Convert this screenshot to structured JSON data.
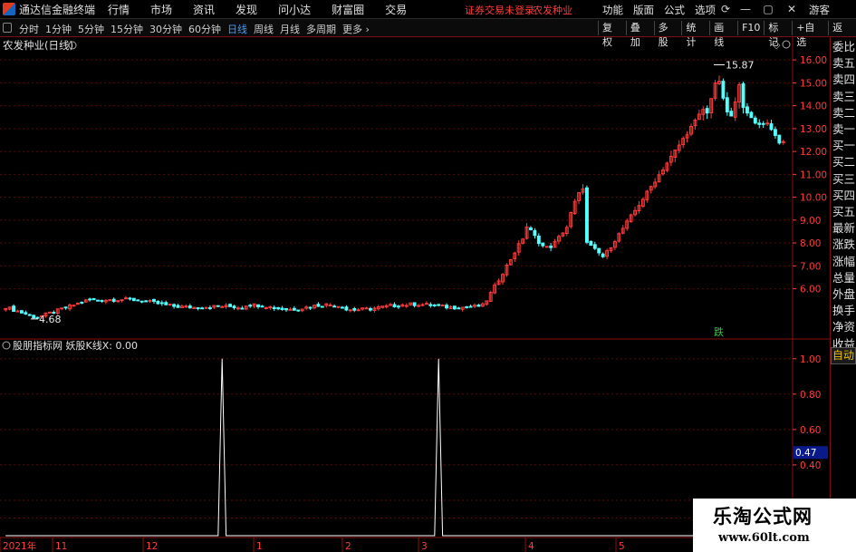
{
  "app": {
    "title": "通达信金融终端",
    "menu": [
      "行情",
      "市场",
      "资讯",
      "发现",
      "问小达",
      "财富圈",
      "交易"
    ],
    "login_status": "证券交易未登录",
    "stock_name": "农发种业",
    "right_menu": [
      "功能",
      "版面",
      "公式",
      "选项"
    ],
    "user": "游客"
  },
  "toolbar": {
    "periods": [
      "分时",
      "1分钟",
      "5分钟",
      "15分钟",
      "30分钟",
      "60分钟",
      "日线",
      "周线",
      "月线",
      "多周期",
      "更多"
    ],
    "active_period": "日线",
    "buttons": [
      "复权",
      "叠加",
      "多股",
      "统计",
      "画线",
      "F10",
      "标记",
      "+自选",
      "返回"
    ]
  },
  "main_panel": {
    "title": "农发种业(日线)",
    "price_axis": [
      "16.00",
      "15.00",
      "14.00",
      "13.00",
      "12.00",
      "11.00",
      "10.00",
      "9.00",
      "8.00",
      "7.00",
      "6.00"
    ],
    "high_label": "15.87",
    "low_label": "4.68",
    "signal_marker": "跌",
    "colors": {
      "up": "#ff3b3b",
      "down": "#54ffff",
      "axis": "#ff3b3b",
      "grid": "#5a0a0a"
    }
  },
  "indicator_panel": {
    "title": "股朋指标网 妖股K线X: 0.00",
    "axis": [
      "1.00",
      "0.80",
      "0.60",
      "0.40"
    ],
    "current_value": "0.47"
  },
  "date_axis": {
    "labels": [
      "2021年",
      "11",
      "12",
      "1",
      "2",
      "3",
      "4",
      "5"
    ]
  },
  "side_panel": {
    "items": [
      "委比",
      "卖五",
      "卖四",
      "卖三",
      "卖二",
      "卖一",
      "买一",
      "买二",
      "买三",
      "买四",
      "买五",
      "最新",
      "涨跌",
      "涨幅",
      "总量",
      "外盘",
      "换手",
      "净资",
      "收益"
    ],
    "auto_label": "自动"
  },
  "watermark": {
    "title": "乐淘公式网",
    "url": "www.60lt.com"
  },
  "chart_data": {
    "type": "candlestick",
    "title": "农发种业(日线)",
    "ylim": [
      4.2,
      16.6
    ],
    "indicator": {
      "name": "妖股K线X",
      "ylim": [
        0,
        1.05
      ],
      "spike_indices": [
        54,
        108
      ]
    },
    "candles": []
  }
}
